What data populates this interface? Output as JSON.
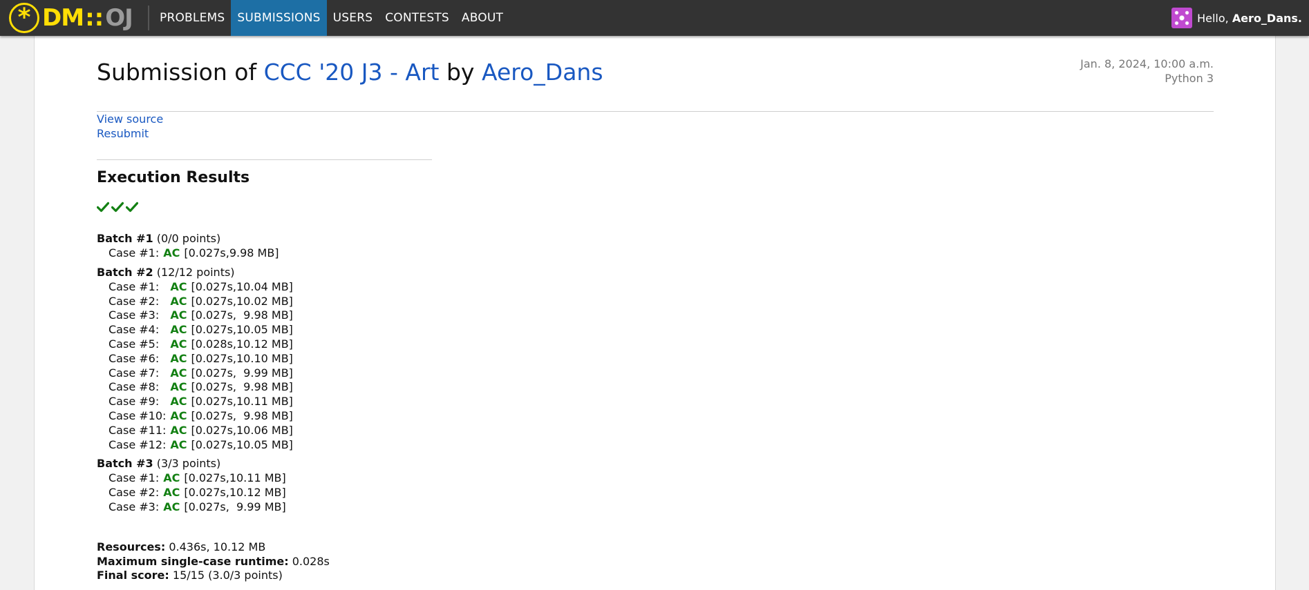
{
  "nav": {
    "logo_symbol": "*",
    "logo_dm": "DM",
    "logo_colons": "::",
    "logo_oj": "OJ",
    "items": [
      {
        "label": "PROBLEMS",
        "active": false
      },
      {
        "label": "SUBMISSIONS",
        "active": true
      },
      {
        "label": "USERS",
        "active": false
      },
      {
        "label": "CONTESTS",
        "active": false
      },
      {
        "label": "ABOUT",
        "active": false
      }
    ],
    "greeting": "Hello,",
    "username": "Aero_Dans",
    "username_suffix": ".",
    "avatar_icon": "identicon-avatar"
  },
  "title": {
    "prefix": "Submission of",
    "problem": "CCC '20 J3 - Art",
    "by": "by",
    "user": "Aero_Dans"
  },
  "meta": {
    "date": "Jan. 8, 2024, 10:00 a.m.",
    "language": "Python 3"
  },
  "links": {
    "view_source": "View source",
    "resubmit": "Resubmit"
  },
  "execution": {
    "title": "Execution Results",
    "check_icons": [
      "check-icon",
      "check-icon",
      "check-icon"
    ],
    "colors": {
      "ac": "#138013",
      "link": "#1958c1",
      "nav_active": "#1d6fa5",
      "nav_bg": "#333333",
      "logo": "#ffde05"
    },
    "batches": [
      {
        "name": "Batch #1",
        "points": "(0/0 points)",
        "cases": [
          {
            "name": "Case #1:",
            "status": "AC",
            "detail": "[0.027s,9.98 MB]"
          }
        ]
      },
      {
        "name": "Batch #2",
        "points": "(12/12 points)",
        "cases": [
          {
            "name": "Case #1:",
            "status": "AC",
            "detail": "[0.027s,10.04 MB]"
          },
          {
            "name": "Case #2:",
            "status": "AC",
            "detail": "[0.027s,10.02 MB]"
          },
          {
            "name": "Case #3:",
            "status": "AC",
            "detail": "[0.027s,  9.98 MB]"
          },
          {
            "name": "Case #4:",
            "status": "AC",
            "detail": "[0.027s,10.05 MB]"
          },
          {
            "name": "Case #5:",
            "status": "AC",
            "detail": "[0.028s,10.12 MB]"
          },
          {
            "name": "Case #6:",
            "status": "AC",
            "detail": "[0.027s,10.10 MB]"
          },
          {
            "name": "Case #7:",
            "status": "AC",
            "detail": "[0.027s,  9.99 MB]"
          },
          {
            "name": "Case #8:",
            "status": "AC",
            "detail": "[0.027s,  9.98 MB]"
          },
          {
            "name": "Case #9:",
            "status": "AC",
            "detail": "[0.027s,10.11 MB]"
          },
          {
            "name": "Case #10:",
            "status": "AC",
            "detail": "[0.027s,  9.98 MB]"
          },
          {
            "name": "Case #11:",
            "status": "AC",
            "detail": "[0.027s,10.06 MB]"
          },
          {
            "name": "Case #12:",
            "status": "AC",
            "detail": "[0.027s,10.05 MB]"
          }
        ]
      },
      {
        "name": "Batch #3",
        "points": "(3/3 points)",
        "cases": [
          {
            "name": "Case #1:",
            "status": "AC",
            "detail": "[0.027s,10.11 MB]"
          },
          {
            "name": "Case #2:",
            "status": "AC",
            "detail": "[0.027s,10.12 MB]"
          },
          {
            "name": "Case #3:",
            "status": "AC",
            "detail": "[0.027s,  9.99 MB]"
          }
        ]
      }
    ]
  },
  "summary": {
    "resources_label": "Resources:",
    "resources_value": "0.436s, 10.12 MB",
    "max_runtime_label": "Maximum single-case runtime:",
    "max_runtime_value": "0.028s",
    "final_score_label": "Final score:",
    "final_score_value": "15/15 (3.0/3 points)"
  }
}
